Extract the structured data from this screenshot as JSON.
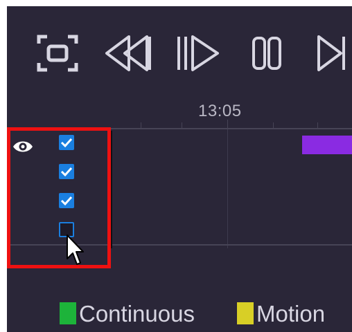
{
  "toolbar": {
    "buttons": [
      {
        "name": "fullscreen",
        "icon": "fullscreen-icon"
      },
      {
        "name": "rewind",
        "icon": "rewind-icon"
      },
      {
        "name": "pause-play",
        "icon": "pause-play-icon"
      },
      {
        "name": "stop",
        "icon": "stop-icon"
      },
      {
        "name": "next",
        "icon": "step-forward-icon"
      }
    ]
  },
  "timeline": {
    "time_label": "13:05",
    "event_color": "#8a2be2"
  },
  "channels": [
    {
      "checked": true
    },
    {
      "checked": true
    },
    {
      "checked": true
    },
    {
      "checked": false
    }
  ],
  "legend": {
    "continuous": {
      "label": "Continuous",
      "color": "#1db33a"
    },
    "motion": {
      "label": "Motion",
      "color": "#d8cf26"
    }
  }
}
